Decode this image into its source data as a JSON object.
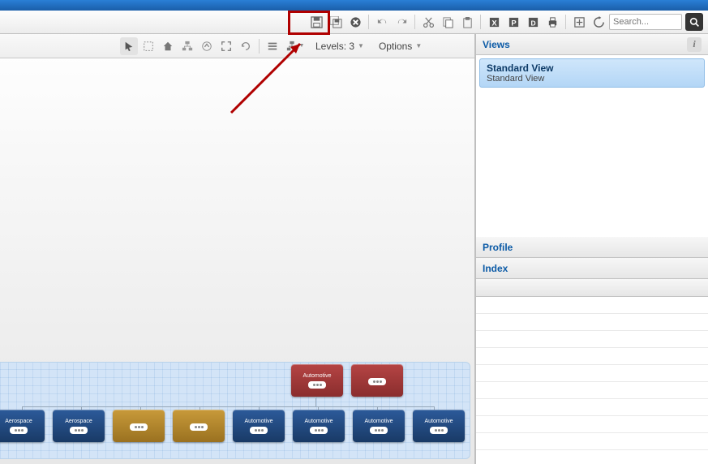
{
  "toolbar1": {
    "save": "Save",
    "saveall": "Save All",
    "close": "Close",
    "undo": "Undo",
    "redo": "Redo",
    "cut": "Cut",
    "copy": "Copy",
    "paste": "Paste",
    "export_excel": "Export Excel",
    "export_ppt": "Export PPT",
    "export_pdf": "Export PDF",
    "print": "Print",
    "fit": "Fit",
    "refresh": "Refresh"
  },
  "search": {
    "placeholder": "Search..."
  },
  "toolbar2": {
    "levels_label": "Levels: 3",
    "options_label": "Options"
  },
  "sidebar": {
    "views_title": "Views",
    "view_item": {
      "title": "Standard View",
      "subtitle": "Standard View"
    },
    "profile_title": "Profile",
    "index_title": "Index"
  },
  "nodes": {
    "row1": [
      {
        "label": "Automotive",
        "cls": "n-red"
      },
      {
        "label": "",
        "cls": "n-red"
      }
    ],
    "row2": [
      {
        "label": "Aerospace",
        "cls": "n-blue"
      },
      {
        "label": "Aerospace",
        "cls": "n-blue"
      },
      {
        "label": "",
        "cls": "n-gold"
      },
      {
        "label": "",
        "cls": "n-gold"
      },
      {
        "label": "Automotive",
        "cls": "n-blue"
      },
      {
        "label": "Automotive",
        "cls": "n-blue"
      },
      {
        "label": "Automotive",
        "cls": "n-blue"
      },
      {
        "label": "Automotive",
        "cls": "n-blue"
      }
    ]
  }
}
